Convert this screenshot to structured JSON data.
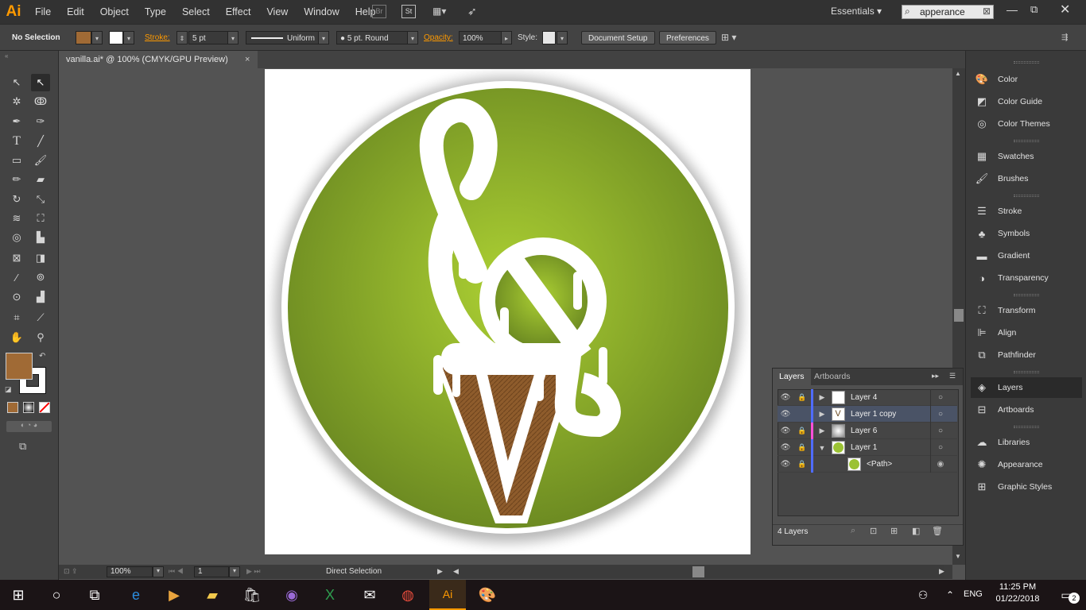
{
  "app": {
    "logo": "Ai",
    "workspace": "Essentials",
    "search_value": "apperance"
  },
  "menu": [
    "File",
    "Edit",
    "Object",
    "Type",
    "Select",
    "Effect",
    "View",
    "Window",
    "Help"
  ],
  "menu_icons": [
    "Br",
    "St"
  ],
  "control": {
    "selection": "No Selection",
    "stroke_label": "Stroke:",
    "stroke_value": "5 pt",
    "profile": "Uniform",
    "brush": "5 pt. Round",
    "opacity_label": "Opacity:",
    "opacity_value": "100%",
    "style_label": "Style:",
    "doc_setup": "Document Setup",
    "preferences": "Preferences"
  },
  "document": {
    "tab_title": "vanilla.ai* @ 100% (CMYK/GPU Preview)",
    "close": "×"
  },
  "status": {
    "zoom": "100%",
    "artboard": "1",
    "tool": "Direct Selection"
  },
  "colors": {
    "fill": "#a06a35",
    "accent": "#ff9a00",
    "circle_green": "#7a9a26",
    "circle_center": "#a8cc33",
    "cone": "#8b5a2b"
  },
  "panels": [
    "Color",
    "Color Guide",
    "Color Themes",
    "Swatches",
    "Brushes",
    "Stroke",
    "Symbols",
    "Gradient",
    "Transparency",
    "Transform",
    "Align",
    "Pathfinder",
    "Layers",
    "Artboards",
    "Libraries",
    "Appearance",
    "Graphic Styles"
  ],
  "panel_icons": [
    "palette-icon",
    "color-guide-icon",
    "color-themes-icon",
    "swatches-icon",
    "brushes-icon",
    "stroke-icon",
    "symbols-icon",
    "gradient-icon",
    "transparency-icon",
    "transform-icon",
    "align-icon",
    "pathfinder-icon",
    "layers-icon",
    "artboards-icon",
    "libraries-icon",
    "appearance-icon",
    "graphic-styles-icon"
  ],
  "layers_panel": {
    "tabs": [
      "Layers",
      "Artboards"
    ],
    "rows": [
      {
        "name": "Layer 4",
        "color": "#4f6cff"
      },
      {
        "name": "Layer 1 copy",
        "color": "#4f6cff"
      },
      {
        "name": "Layer 6",
        "color": "#ff4fd8"
      },
      {
        "name": "Layer 1",
        "color": "#4f6cff"
      },
      {
        "name": "<Path>",
        "color": "#4f6cff"
      }
    ],
    "count": "4 Layers"
  },
  "taskbar": {
    "lang": "ENG",
    "time": "11:25 PM",
    "date": "01/22/2018",
    "notif": "2"
  }
}
